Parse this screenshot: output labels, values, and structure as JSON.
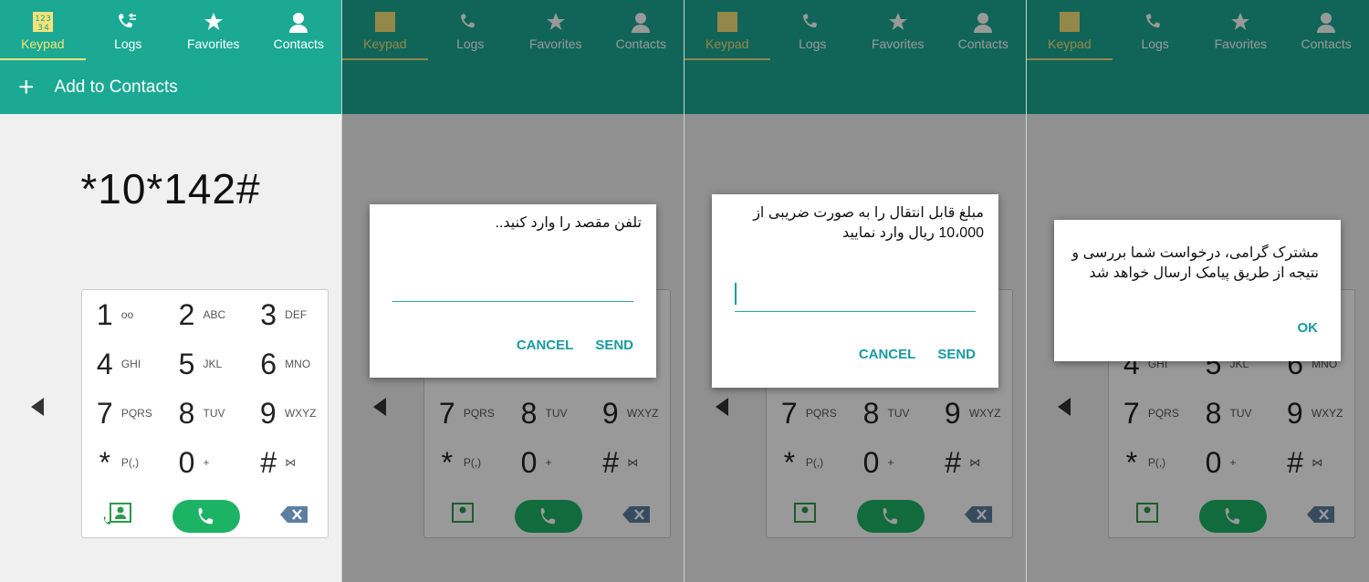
{
  "tabs": [
    {
      "label": "Keypad",
      "icon": "keypad-icon"
    },
    {
      "label": "Logs",
      "icon": "logs-icon"
    },
    {
      "label": "Favorites",
      "icon": "star-icon"
    },
    {
      "label": "Contacts",
      "icon": "person-icon"
    }
  ],
  "add_to_contacts": {
    "plus": "+",
    "label": "Add to Contacts"
  },
  "dialed_number": "*10*142#",
  "keypad": {
    "keys": [
      {
        "digit": "1",
        "letters": "oo"
      },
      {
        "digit": "2",
        "letters": "ABC"
      },
      {
        "digit": "3",
        "letters": "DEF"
      },
      {
        "digit": "4",
        "letters": "GHI"
      },
      {
        "digit": "5",
        "letters": "JKL"
      },
      {
        "digit": "6",
        "letters": "MNO"
      },
      {
        "digit": "7",
        "letters": "PQRS"
      },
      {
        "digit": "8",
        "letters": "TUV"
      },
      {
        "digit": "9",
        "letters": "WXYZ"
      },
      {
        "digit": "*",
        "letters": "P(,)"
      },
      {
        "digit": "0",
        "letters": "+"
      },
      {
        "digit": "#",
        "letters": "⋈"
      }
    ]
  },
  "dialog_enter_number": {
    "text": "تلفن مقصد را وارد کنید..",
    "cancel": "CANCEL",
    "send": "SEND"
  },
  "dialog_enter_amount": {
    "line1": "مبلغ قابل انتقال را به صورت ضریبی از",
    "line2": "10،000 ریال وارد نمایید",
    "cancel": "CANCEL",
    "send": "SEND"
  },
  "dialog_result": {
    "line1": "مشترک گرامی، درخواست شما بررسی و",
    "line2": "نتیجه از طریق پیامک ارسال خواهد شد",
    "ok": "OK"
  },
  "colors": {
    "accent": "#1ba993",
    "active_tab": "#f6e27a",
    "call_green": "#1db365",
    "dialog_button": "#1a9aa0"
  }
}
